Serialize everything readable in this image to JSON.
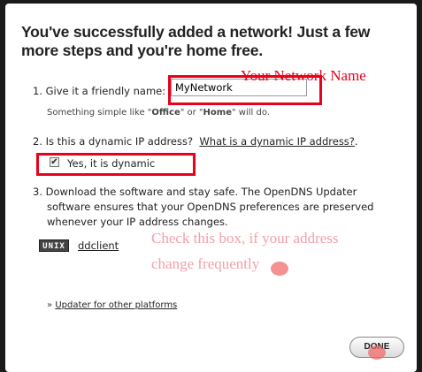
{
  "dialog": {
    "heading": "You've successfully added a network! Just a few more steps and you're home free.",
    "step1": {
      "label": "1. Give it a friendly name:",
      "input_value": "MyNetwork",
      "hint_prefix": "Something simple like \"",
      "hint_office": "Office",
      "hint_mid": "\" or \"",
      "hint_home": "Home",
      "hint_suffix": "\" will do."
    },
    "step2": {
      "label": "2. Is this a dynamic IP address?",
      "help_link": "What is a dynamic IP address?",
      "help_link_suffix": ".",
      "checkbox_label": "Yes, it is dynamic",
      "checkbox_mark": "✔"
    },
    "step3": {
      "line1": "3. Download the software and stay safe. The OpenDNS Updater",
      "line2": "software ensures that your OpenDNS preferences are preserved",
      "line3": "whenever your IP address changes.",
      "unix_badge": "UNIX",
      "ddclient": "ddclient"
    },
    "other_platforms_prefix": "»",
    "other_platforms_link": "Updater for other platforms",
    "done_button": "DONE"
  },
  "annotations": {
    "network_name": "Your Network Name",
    "check_line1": "Check this box, if your address",
    "check_line2": "change frequently",
    "color": "#e8001c"
  }
}
